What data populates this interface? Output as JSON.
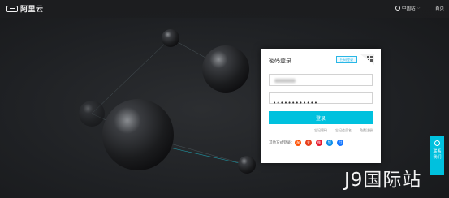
{
  "header": {
    "brand": "阿里云",
    "region": "中国站",
    "home": "首页"
  },
  "login": {
    "title": "密码登录",
    "qr_badge": "扫码登录",
    "username_value": "",
    "password_value": "••••••••••••",
    "submit_label": "登录",
    "links": [
      "忘记密码",
      "忘记会员名",
      "免费注册"
    ],
    "other_methods": "其他方式登录：",
    "social": [
      {
        "icon": "taobao-icon",
        "glyph": "淘",
        "color": "#ff5000"
      },
      {
        "icon": "alipay-red-icon",
        "glyph": "支",
        "color": "#e8401c"
      },
      {
        "icon": "weibo-icon",
        "glyph": "微",
        "color": "#e6162d"
      },
      {
        "icon": "dingtalk-icon",
        "glyph": "钉",
        "color": "#0d8fe8"
      },
      {
        "icon": "alipay-icon",
        "glyph": "付",
        "color": "#1677ff"
      }
    ]
  },
  "side_tab": {
    "label_line1": "联系",
    "label_line2": "我们"
  },
  "watermark": "J9国际站"
}
